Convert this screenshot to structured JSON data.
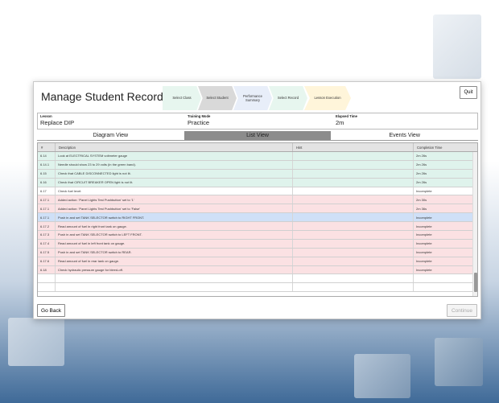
{
  "colors": {
    "step_fills": [
      "#e7f6ef",
      "#d9d9d9",
      "#e8eef9",
      "#e7f6ef",
      "#fff5da"
    ],
    "row_fills": {
      "green": "#dff3ec",
      "white": "#ffffff",
      "pink": "#fbe1e3",
      "blue": "#cfe0f7"
    }
  },
  "header": {
    "title": "Manage Student Records",
    "steps": [
      "Select Class",
      "Select Student",
      "Performance Summary",
      "Select Record",
      "Lesson Execution"
    ],
    "quit_label": "Quit"
  },
  "info": {
    "lesson_label": "Lesson",
    "lesson_value": "Replace DIP",
    "mode_label": "Training Mode",
    "mode_value": "Practice",
    "elapsed_label": "Elapsed Time",
    "elapsed_value": "2m"
  },
  "tabs": [
    "Diagram View",
    "List View",
    "Events View"
  ],
  "table": {
    "columns": [
      "#",
      "Description",
      "Hint",
      "Completion Time"
    ],
    "rows": [
      {
        "num": "6.14",
        "desc": "Look at ELECTRICAL SYSTEM voltmeter gauge",
        "hint": "",
        "time": "2m 26s",
        "color": "green"
      },
      {
        "num": "6.14.1",
        "desc": "    Needle should show 23 to 29 volts (in the green band).",
        "hint": "",
        "time": "2m 26s",
        "color": "green"
      },
      {
        "num": "6.15",
        "desc": "Check that CABLE DISCONNECTED light is not lit.",
        "hint": "",
        "time": "2m 26s",
        "color": "green"
      },
      {
        "num": "6.16",
        "desc": "Check that CIRCUIT BREAKER OPEN light is not lit.",
        "hint": "",
        "time": "2m 26s",
        "color": "green"
      },
      {
        "num": "6.17",
        "desc": "Check fuel level:",
        "hint": "",
        "time": "Incomplete",
        "color": "white"
      },
      {
        "num": "6.17.1",
        "desc": "    Added action: 'Panel Lights Test Pushbutton' set to '1'",
        "hint": "",
        "time": "2m 30s",
        "color": "pink"
      },
      {
        "num": "6.17.1",
        "desc": "    Added action: 'Panel Lights Test Pushbutton' set to 'False'",
        "hint": "",
        "time": "2m 36s",
        "color": "pink"
      },
      {
        "num": "6.17.1",
        "desc": "    Push in and set TANK SELECTOR switch to RIGHT FRONT.",
        "hint": "",
        "time": "Incomplete",
        "color": "blue"
      },
      {
        "num": "6.17.2",
        "desc": "    Read amount of fuel in right front tank on gauge.",
        "hint": "",
        "time": "Incomplete",
        "color": "pink"
      },
      {
        "num": "6.17.3",
        "desc": "    Push in and set TANK SELECTOR switch to LEFT FRONT.",
        "hint": "",
        "time": "Incomplete",
        "color": "pink"
      },
      {
        "num": "6.17.4",
        "desc": "    Read amount of fuel in left front tank on gauge.",
        "hint": "",
        "time": "Incomplete",
        "color": "pink"
      },
      {
        "num": "6.17.5",
        "desc": "    Push in and set TANK SELECTOR switch to REAR.",
        "hint": "",
        "time": "Incomplete",
        "color": "pink"
      },
      {
        "num": "6.17.6",
        "desc": "    Read amount of fuel in rear tank on gauge.",
        "hint": "",
        "time": "Incomplete",
        "color": "pink"
      },
      {
        "num": "6.18",
        "desc": "Check hydraulic pressure gauge for bleed-off.",
        "hint": "",
        "time": "Incomplete",
        "color": "pink"
      },
      {
        "num": "",
        "desc": "",
        "hint": "",
        "time": "",
        "color": "white"
      },
      {
        "num": "",
        "desc": "",
        "hint": "",
        "time": "",
        "color": "white"
      }
    ]
  },
  "footer": {
    "back_label": "Go Back",
    "continue_label": "Continue"
  }
}
